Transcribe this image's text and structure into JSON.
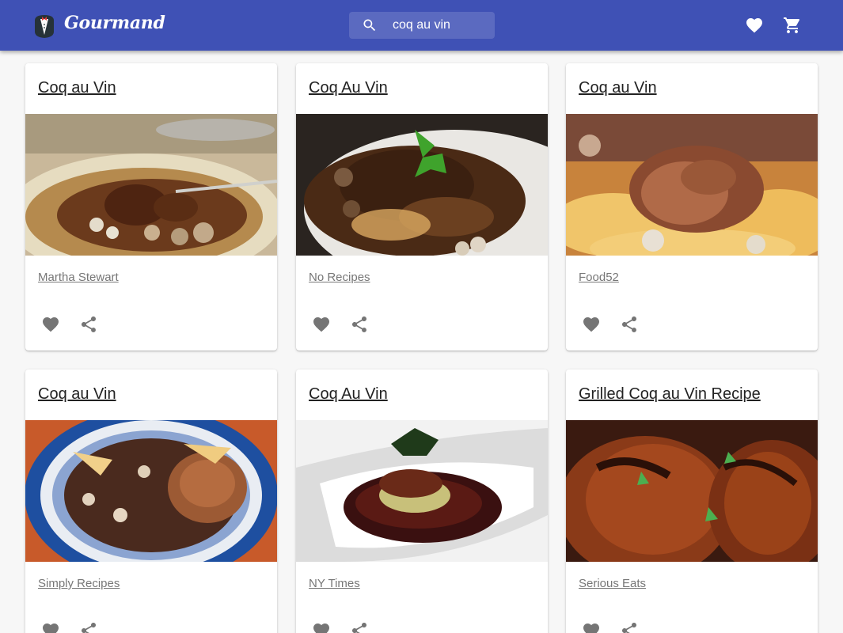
{
  "app": {
    "brand": "Gourmand"
  },
  "search": {
    "value": "coq au vin"
  },
  "header": {
    "icons": [
      "heart-icon",
      "cart-icon"
    ]
  },
  "colors": {
    "appbar": "#3f51b5",
    "background": "#f7f7f7",
    "card": "#ffffff",
    "icon": "#757575"
  },
  "recipes": [
    {
      "title": "Coq au Vin",
      "source": "Martha Stewart"
    },
    {
      "title": "Coq Au Vin",
      "source": "No Recipes"
    },
    {
      "title": "Coq au Vin",
      "source": "Food52"
    },
    {
      "title": "Coq au Vin",
      "source": "Simply Recipes"
    },
    {
      "title": "Coq Au Vin",
      "source": "NY Times"
    },
    {
      "title": "Grilled Coq au Vin Recipe",
      "source": "Serious Eats"
    }
  ]
}
